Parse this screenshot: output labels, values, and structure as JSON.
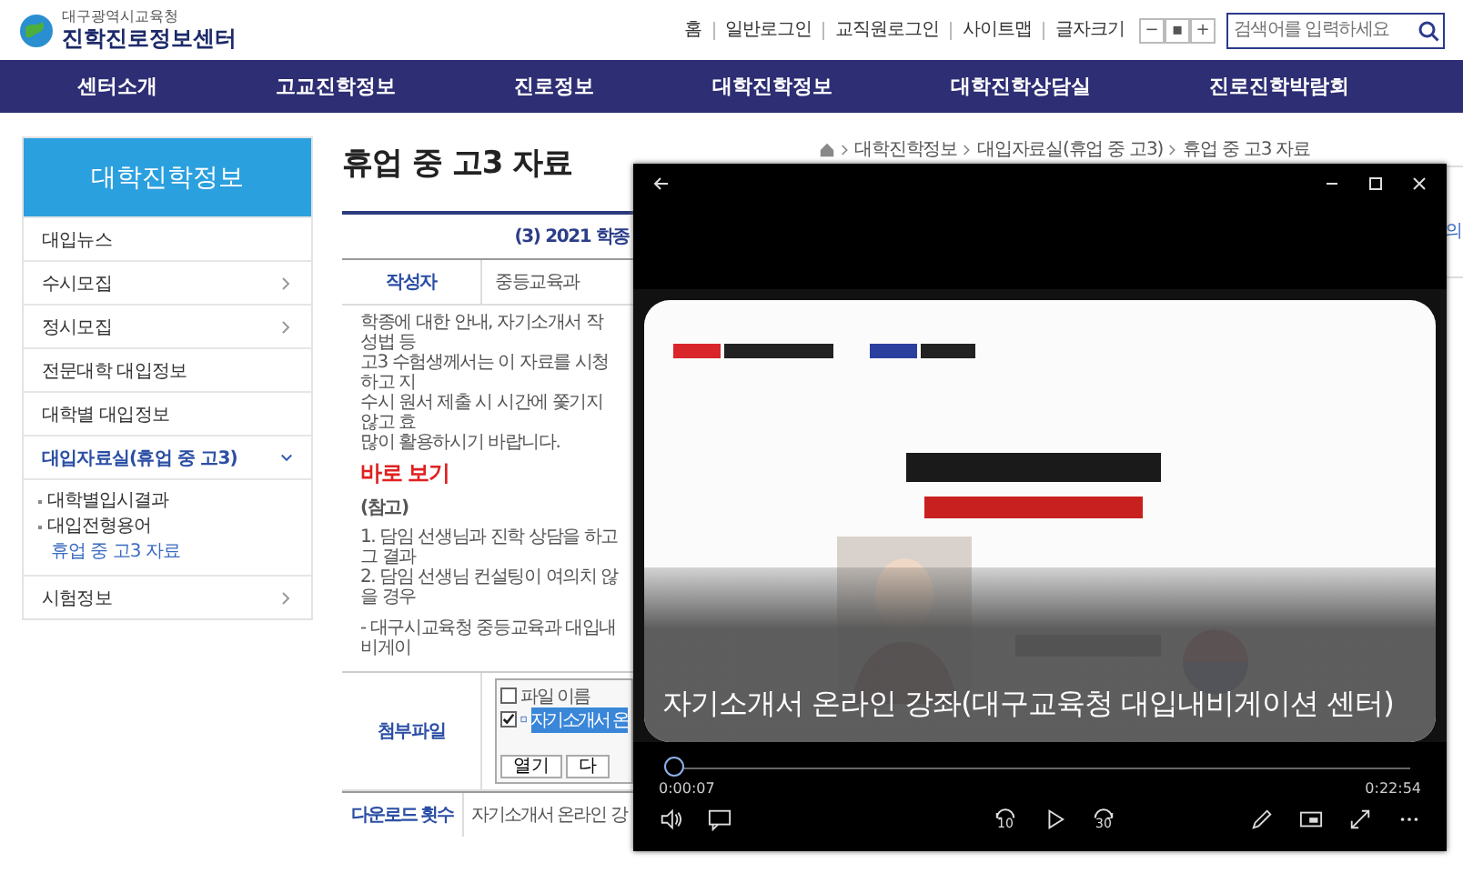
{
  "header": {
    "org": "대구광역시교육청",
    "site": "진학진로정보센터",
    "links": [
      "홈",
      "일반로그인",
      "교직원로그인",
      "사이트맵",
      "글자크기"
    ],
    "font_buttons": [
      "−",
      "▪",
      "+"
    ],
    "search": {
      "placeholder": "검색어를 입력하세요"
    }
  },
  "nav": [
    "센터소개",
    "고교진학정보",
    "진로정보",
    "대학진학정보",
    "대학진학상담실",
    "진로진학박람회"
  ],
  "breadcrumb": [
    "대학진학정보",
    "대입자료실(휴업 중 고3)",
    "휴업 중 고3 자료"
  ],
  "sidebar": {
    "title": "대학진학정보",
    "items": [
      {
        "label": "대입뉴스",
        "kind": "plain"
      },
      {
        "label": "수시모집",
        "kind": "arrow"
      },
      {
        "label": "정시모집",
        "kind": "arrow"
      },
      {
        "label": "전문대학 대입정보",
        "kind": "plain"
      },
      {
        "label": "대학별 대입정보",
        "kind": "plain"
      },
      {
        "label": "대입자료실(휴업 중 고3)",
        "kind": "group",
        "expanded": true,
        "children": [
          {
            "label": "대학별입시결과",
            "selected": false
          },
          {
            "label": "대입전형용어",
            "selected": false
          },
          {
            "label": "휴업 중 고3 자료",
            "selected": true
          }
        ]
      },
      {
        "label": "시험정보",
        "kind": "arrow"
      }
    ]
  },
  "article": {
    "title": "휴업 중 고3 자료",
    "subject": "(3) 2021 학종",
    "author_label": "작성자",
    "author": "중등교육과",
    "paragraph": [
      "학종에 대한 안내, 자기소개서 작성법 등",
      "고3 수험생께서는 이 자료를 시청하고 지",
      "수시 원서 제출 시 시간에 쫓기지 않고 효",
      "많이 활용하시기 바랍니다."
    ],
    "link": "바로 보기",
    "note_title": "(참고)",
    "notes": [
      "1. 담임 선생님과 진학 상담을 하고 그 결과",
      "2. 담임 선생님 컨설팅이 여의치 않을 경우"
    ],
    "source": "- 대구시교육청 중등교육과 대입내비게이",
    "attachment_label": "첨부파일",
    "files": {
      "header": {
        "label": "파일 이름",
        "checked": false
      },
      "rows": [
        {
          "label": "자기소개서 온",
          "checked": true,
          "selected": true
        }
      ],
      "buttons": [
        "열기",
        "다"
      ]
    },
    "downloads_label": "다운로드 횟수",
    "downloads": "자기소개서 온라인 강"
  },
  "aside": {
    "text": "의"
  },
  "player": {
    "caption": "자기소개서 온라인 강좌(대구교육청 대입내비게이션 센터)",
    "progress": {
      "level": 0.005
    },
    "elapsed": "0:00:07",
    "duration": "0:22:54",
    "skip_back": "10",
    "skip_forward": "30"
  }
}
